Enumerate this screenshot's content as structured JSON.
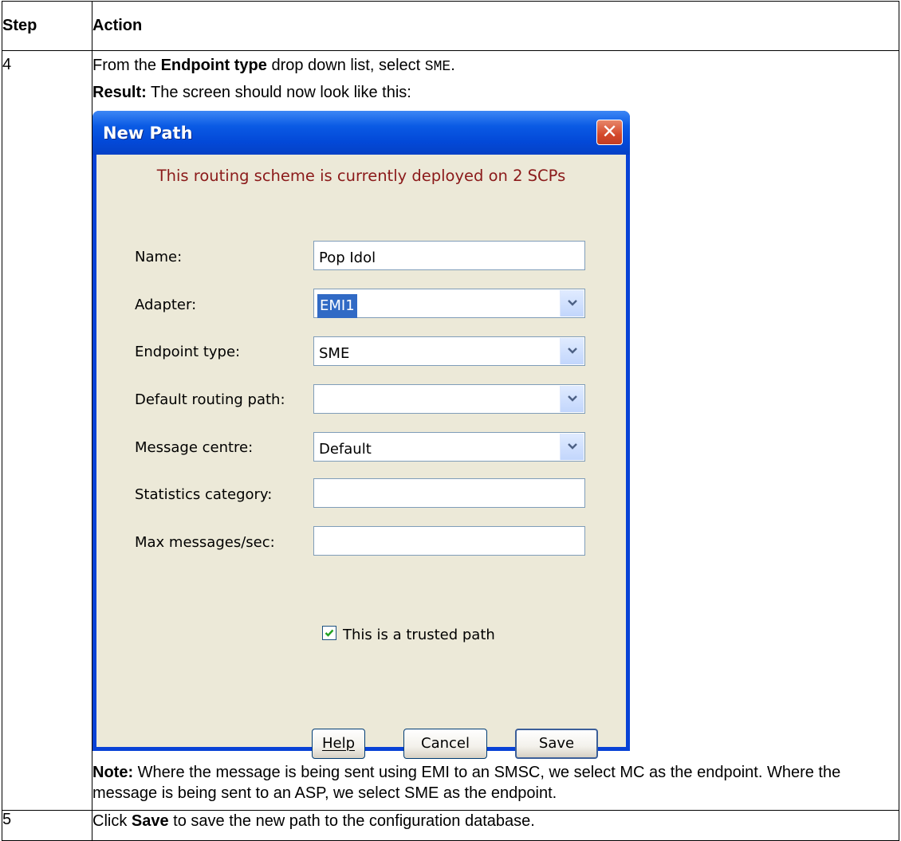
{
  "table": {
    "headers": {
      "step": "Step",
      "action": "Action"
    },
    "rows": [
      {
        "step": "4",
        "line1": {
          "pre": "From the ",
          "bold": "Endpoint type",
          "mid": " drop down list, select ",
          "code": "SME",
          "post": "."
        },
        "result": {
          "bold": "Result:",
          "text": " The screen should now look like this:"
        },
        "note": {
          "bold": "Note:",
          "text": " Where the message is being sent using EMI to an SMSC, we select MC as the endpoint. Where the message is being sent to an ASP, we select SME as the endpoint."
        }
      },
      {
        "step": "5",
        "pre": "Click ",
        "bold": "Save",
        "post": " to save the new path to the configuration database."
      }
    ]
  },
  "dialog": {
    "title": "New Path",
    "close_glyph": "✕",
    "deploy_message": "This routing scheme is currently deployed on 2 SCPs",
    "fields": {
      "name": {
        "label": "Name:",
        "value": "Pop Idol"
      },
      "adapter": {
        "label": "Adapter:",
        "value": "EMI1"
      },
      "endpoint_type": {
        "label": "Endpoint type:",
        "value": "SME"
      },
      "default_routing_path": {
        "label": "Default routing path:",
        "value": ""
      },
      "message_centre": {
        "label": "Message centre:",
        "value": "Default"
      },
      "statistics_category": {
        "label": "Statistics category:",
        "value": ""
      },
      "max_messages": {
        "label": "Max messages/sec:",
        "value": ""
      }
    },
    "trusted": {
      "label": "This is a trusted path",
      "checked": true
    },
    "buttons": {
      "help": "Help",
      "cancel": "Cancel",
      "save": "Save"
    },
    "colors": {
      "titlebar": "#0a5ae4",
      "client": "#ece9d8",
      "message": "#8b1a1a",
      "selection": "#316ac5"
    },
    "icons": {
      "close": "close-icon",
      "dropdown": "chevron-down-icon",
      "check": "checkmark-icon"
    }
  }
}
